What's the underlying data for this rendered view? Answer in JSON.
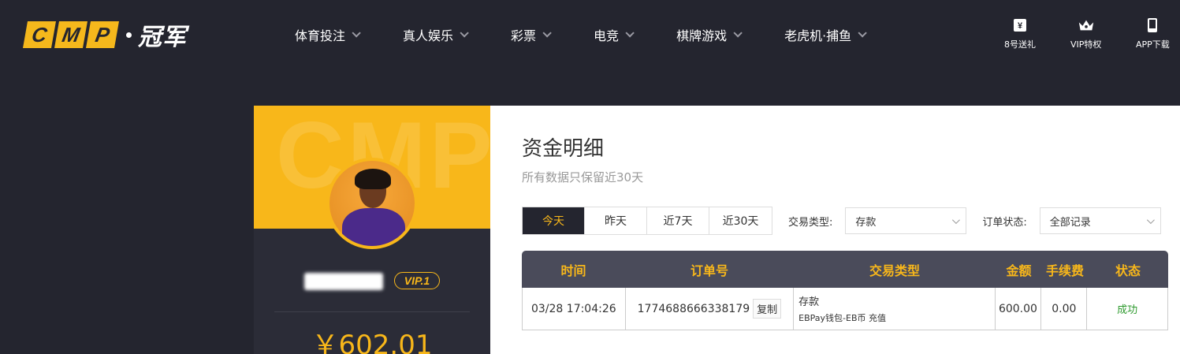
{
  "brand": {
    "letters": [
      "C",
      "M",
      "P"
    ],
    "cn": "冠军"
  },
  "nav": [
    {
      "label": "体育投注"
    },
    {
      "label": "真人娱乐"
    },
    {
      "label": "彩票"
    },
    {
      "label": "电竞"
    },
    {
      "label": "棋牌游戏"
    },
    {
      "label": "老虎机·捕鱼"
    }
  ],
  "quick_links": [
    {
      "label": "8号送礼",
      "icon": "ticket-icon"
    },
    {
      "label": "VIP特权",
      "icon": "crown-icon"
    },
    {
      "label": "APP下载",
      "icon": "phone-icon"
    }
  ],
  "profile": {
    "watermark": "CMP",
    "vip": "VIP.1",
    "balance": "￥602.01"
  },
  "page": {
    "title": "资金明细",
    "subtitle": "所有数据只保留近30天"
  },
  "filters": {
    "ranges": [
      "今天",
      "昨天",
      "近7天",
      "近30天"
    ],
    "active_range": "今天",
    "type_label": "交易类型:",
    "type_value": "存款",
    "status_label": "订单状态:",
    "status_value": "全部记录"
  },
  "table": {
    "headers": [
      "时间",
      "订单号",
      "交易类型",
      "金额",
      "手续费",
      "状态"
    ],
    "rows": [
      {
        "time": "03/28 17:04:26",
        "order": "1774688666338179",
        "copy": "复制",
        "type": "存款",
        "type_detail": "EBPay钱包-EB币 充值",
        "amount": "600.00",
        "fee": "0.00",
        "status": "成功"
      }
    ]
  },
  "colors": {
    "accent": "#f8b71a",
    "header_bg": "#24252f",
    "table_head": "#4a4b5a",
    "success": "#2e9a2e"
  }
}
